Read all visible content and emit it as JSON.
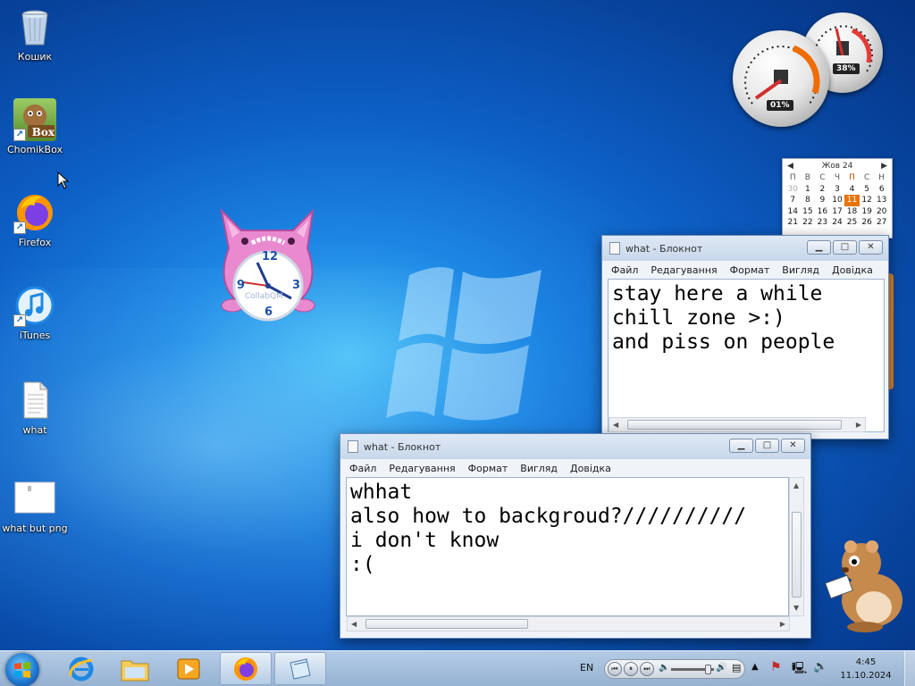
{
  "desktop": {
    "icons": [
      {
        "label": "Кошик",
        "icon": "recycle-bin-icon"
      },
      {
        "label": "ChomikBox",
        "icon": "chomikbox-app-icon",
        "badge": "Box"
      },
      {
        "label": "Firefox",
        "icon": "firefox-icon"
      },
      {
        "label": "iTunes",
        "icon": "itunes-icon"
      },
      {
        "label": "what",
        "icon": "text-file-icon"
      },
      {
        "label": "what but png",
        "icon": "image-file-icon"
      }
    ]
  },
  "gadgets": {
    "cat_clock": {
      "hours": [
        "12",
        "3",
        "6",
        "9"
      ],
      "watermark": "CollabQM"
    },
    "cpu_meter": {
      "cpu_percent": "01%",
      "memory_percent": "38%"
    },
    "calendar": {
      "month": "Жов 24",
      "prev": "◀",
      "next": "▶",
      "weekdays": [
        "П",
        "В",
        "С",
        "Ч",
        "П",
        "С",
        "Н"
      ],
      "weeks": [
        [
          "30",
          "1",
          "2",
          "3",
          "4",
          "5",
          "6"
        ],
        [
          "7",
          "8",
          "9",
          "10",
          "11",
          "12",
          "13"
        ],
        [
          "14",
          "15",
          "16",
          "17",
          "18",
          "19",
          "20"
        ],
        [
          "21",
          "22",
          "23",
          "24",
          "25",
          "26",
          "27"
        ]
      ],
      "today": "11"
    }
  },
  "windows": [
    {
      "title": "what - Блокнот",
      "menu": [
        "Файл",
        "Редагування",
        "Формат",
        "Вигляд",
        "Довідка"
      ],
      "lines": [
        "stay here a while",
        "chill zone >:)",
        "and piss on people"
      ]
    },
    {
      "title": "what - Блокнот",
      "menu": [
        "Файл",
        "Редагування",
        "Формат",
        "Вигляд",
        "Довідка"
      ],
      "lines": [
        "whhat",
        "also how to backgroud?//////////",
        "i don't know",
        ":("
      ]
    }
  ],
  "taskbar": {
    "pinned": [
      "internet-explorer-icon",
      "explorer-folder-icon",
      "media-player-icon",
      "firefox-icon",
      "notepad-icon"
    ],
    "language": "EN",
    "time": "4:45",
    "date": "11.10.2024"
  },
  "colors": {
    "accent": "#e8740a",
    "desktop_blue": "#0d5fc6"
  }
}
